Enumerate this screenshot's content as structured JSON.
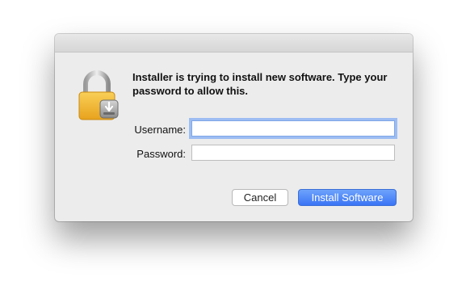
{
  "dialog": {
    "message": "Installer is trying to install new software. Type your password to allow this.",
    "icon": "lock-icon"
  },
  "form": {
    "username_label": "Username:",
    "username_value": "",
    "password_label": "Password:",
    "password_value": ""
  },
  "buttons": {
    "cancel_label": "Cancel",
    "install_label": "Install Software"
  },
  "colors": {
    "accent": "#3a74f5",
    "lock_gold": "#f2b73a",
    "dialog_bg": "#ececec"
  }
}
